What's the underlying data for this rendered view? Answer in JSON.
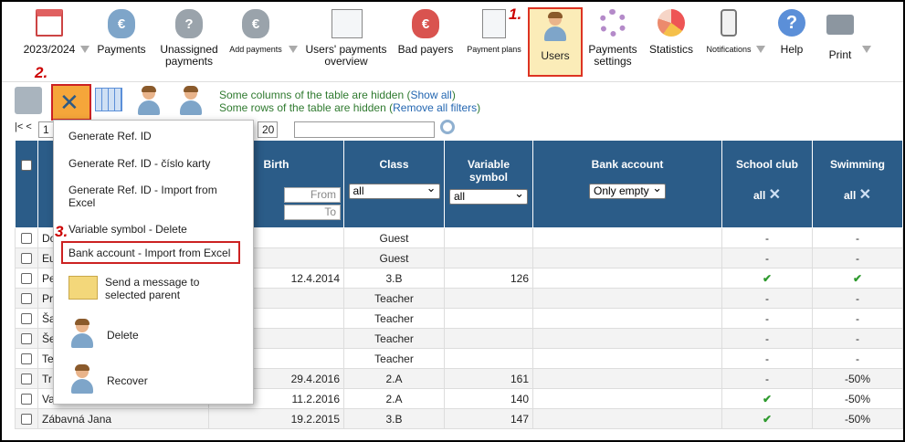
{
  "toolbar": {
    "year": "2023/2024",
    "payments": "Payments",
    "unassigned": "Unassigned payments",
    "add_payments": "Add payments",
    "users_payments_overview": "Users' payments overview",
    "bad_payers": "Bad payers",
    "payment_plans": "Payment plans",
    "users": "Users",
    "payments_settings": "Payments settings",
    "statistics": "Statistics",
    "notifications": "Notifications",
    "help": "Help",
    "print": "Print"
  },
  "steps": {
    "s1": "1.",
    "s2": "2.",
    "s3": "3."
  },
  "hidden": {
    "cols_text": "Some columns of the table are hidden (",
    "cols_link": "Show all",
    "rows_text": "Some rows of the table are hidden (",
    "rows_link": "Remove all filters",
    "close": ")"
  },
  "pager": {
    "first": "|< <",
    "page": "1",
    "per_page": "20",
    "search_value": ""
  },
  "table": {
    "headers": {
      "birth": "Birth",
      "class": "Class",
      "variable_symbol": "Variable symbol",
      "bank_account": "Bank account",
      "school_club": "School club",
      "swimming": "Swimming"
    },
    "filters": {
      "from": "From",
      "to": "To",
      "class": "all",
      "vs": "all",
      "bank": "Only empty",
      "club": "all",
      "swim": "all"
    },
    "rows": [
      {
        "name": "Do",
        "birth": "",
        "class": "Guest",
        "vs": "",
        "bank": "",
        "club": "-",
        "swim": "-"
      },
      {
        "name": "Eu",
        "birth": "",
        "class": "Guest",
        "vs": "",
        "bank": "",
        "club": "-",
        "swim": "-"
      },
      {
        "name": "Pe",
        "birth": "12.4.2014",
        "class": "3.B",
        "vs": "126",
        "bank": "",
        "club": "✔",
        "swim": "✔"
      },
      {
        "name": "Pr",
        "birth": "",
        "class": "Teacher",
        "vs": "",
        "bank": "",
        "club": "-",
        "swim": "-"
      },
      {
        "name": "Ša",
        "birth": "",
        "class": "Teacher",
        "vs": "",
        "bank": "",
        "club": "-",
        "swim": "-"
      },
      {
        "name": "Še",
        "birth": "",
        "class": "Teacher",
        "vs": "",
        "bank": "",
        "club": "-",
        "swim": "-"
      },
      {
        "name": "Te",
        "birth": "",
        "class": "Teacher",
        "vs": "",
        "bank": "",
        "club": "-",
        "swim": "-"
      },
      {
        "name": "Tr",
        "birth": "29.4.2016",
        "class": "2.A",
        "vs": "161",
        "bank": "",
        "club": "-",
        "swim": "-50%"
      },
      {
        "name": "Va",
        "birth": "11.2.2016",
        "class": "2.A",
        "vs": "140",
        "bank": "",
        "club": "✔",
        "swim": "-50%"
      },
      {
        "name": "Zábavná Jana",
        "birth": "19.2.2015",
        "class": "3.B",
        "vs": "147",
        "bank": "",
        "club": "✔",
        "swim": "-50%"
      }
    ]
  },
  "menu": {
    "gen_ref": "Generate Ref. ID",
    "gen_ref_card": "Generate Ref. ID - číslo karty",
    "gen_ref_import": "Generate Ref. ID - Import from Excel",
    "vs_delete": "Variable symbol - Delete",
    "bank_import": "Bank account - Import from Excel",
    "send_msg": "Send a message to selected parent",
    "delete": "Delete",
    "recover": "Recover"
  }
}
